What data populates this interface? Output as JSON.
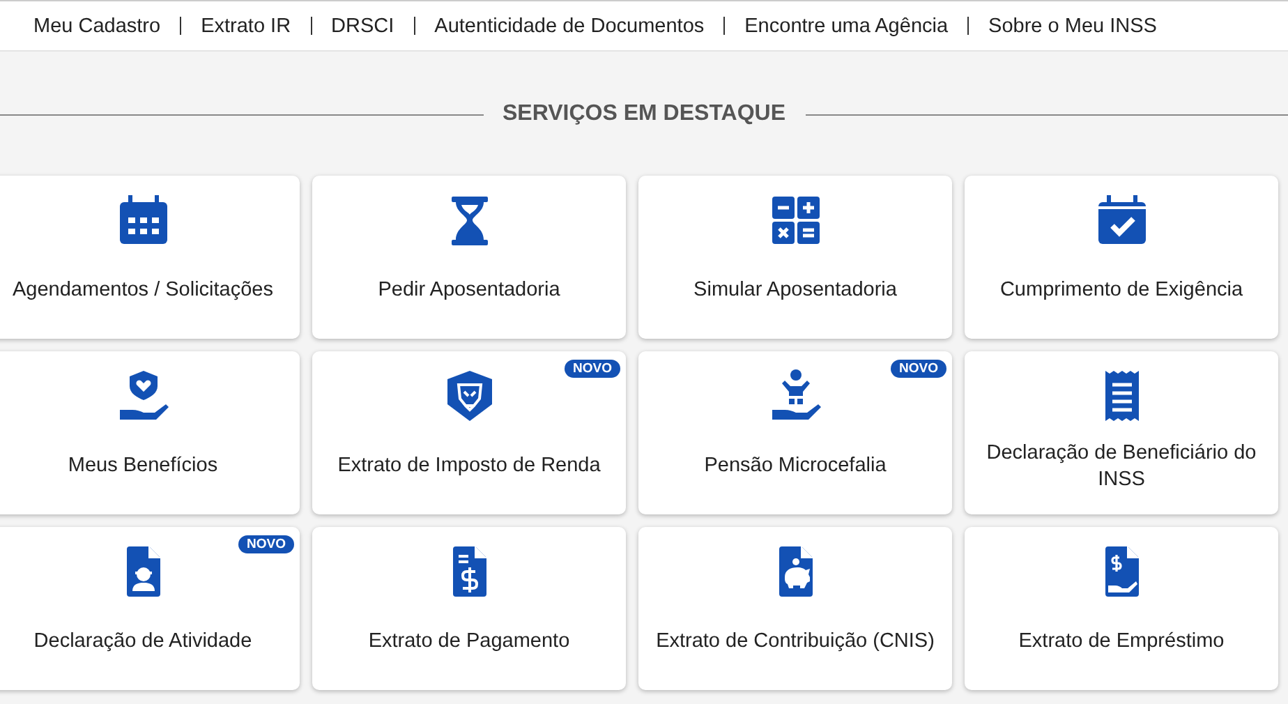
{
  "nav": [
    {
      "label": "Meu Cadastro"
    },
    {
      "label": "Extrato IR"
    },
    {
      "label": "DRSCI"
    },
    {
      "label": "Autenticidade de Documentos"
    },
    {
      "label": "Encontre uma Agência"
    },
    {
      "label": "Sobre o Meu INSS"
    }
  ],
  "section_title": "SERVIÇOS EM DESTAQUE",
  "services": [
    {
      "label": "Agendamentos / Solicitações"
    },
    {
      "label": "Pedir Aposentadoria"
    },
    {
      "label": "Simular Aposentadoria"
    },
    {
      "label": "Cumprimento de Exigência"
    },
    {
      "label": "Meus Benefícios"
    },
    {
      "label": "Extrato de Imposto de Renda",
      "badge": "NOVO"
    },
    {
      "label": "Pensão Microcefalia",
      "badge": "NOVO"
    },
    {
      "label": "Declaração de Beneficiário do INSS"
    },
    {
      "label": "Declaração de Atividade",
      "badge": "NOVO"
    },
    {
      "label": "Extrato de Pagamento"
    },
    {
      "label": "Extrato de Contribuição (CNIS)"
    },
    {
      "label": "Extrato de Empréstimo"
    }
  ]
}
